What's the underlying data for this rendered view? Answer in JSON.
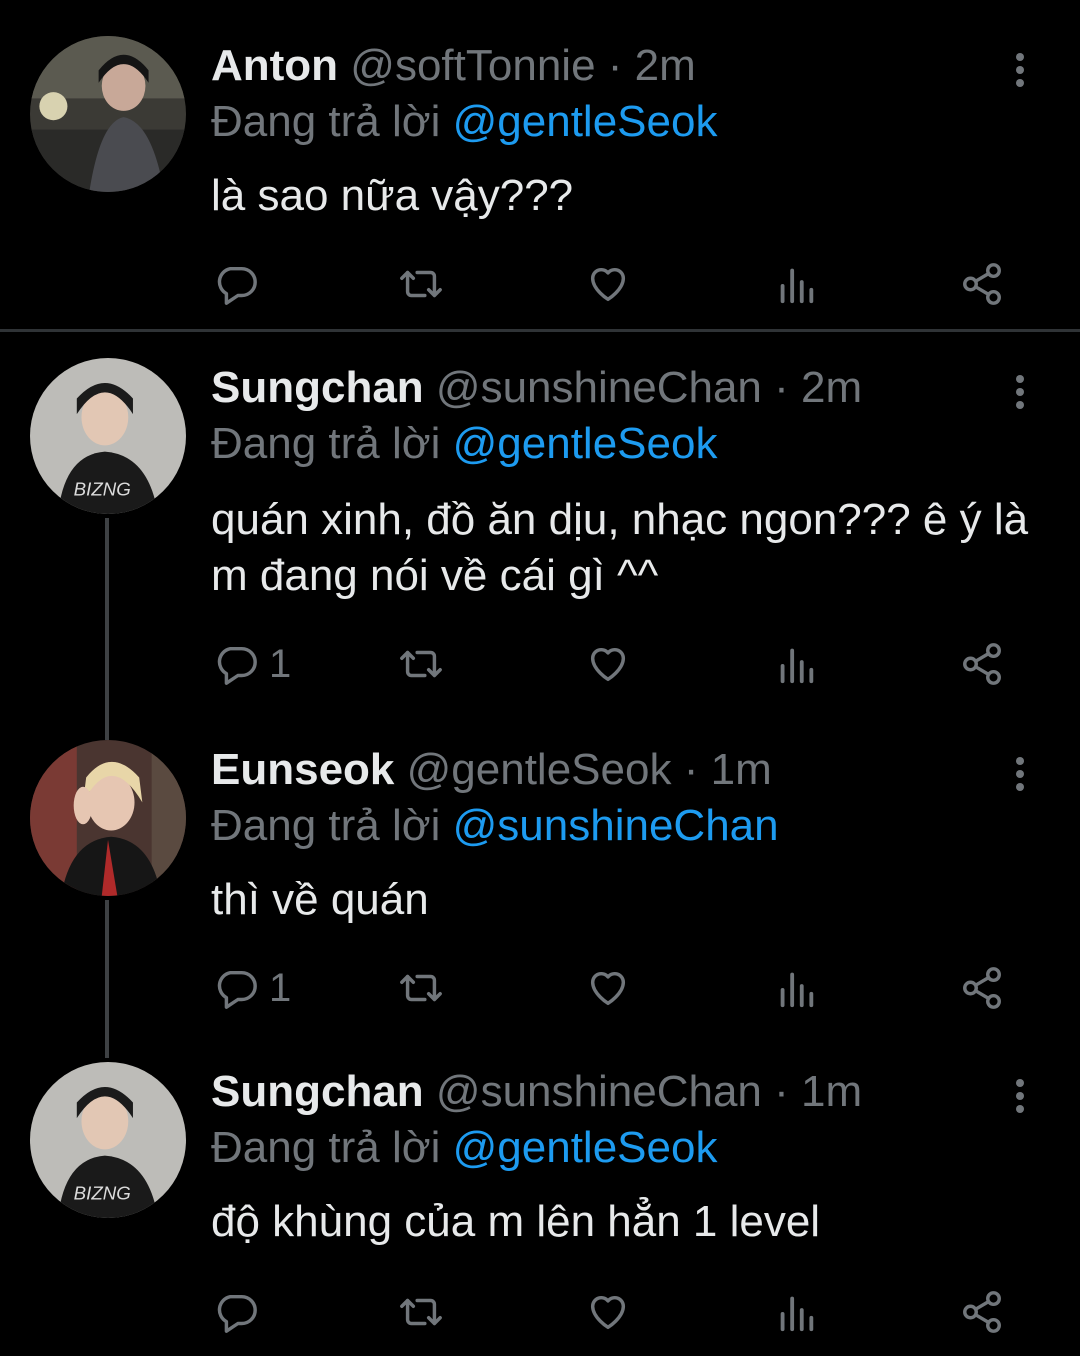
{
  "colors": {
    "background": "#000000",
    "name": "#e7e9ea",
    "muted": "#71767b",
    "accent": "#1d9bf0"
  },
  "tweets": [
    {
      "name": "Anton",
      "handle": "@softTonnie",
      "separator": "·",
      "time": "2m",
      "replying_prefix": "Đang trả lời",
      "replying_to": "@gentleSeok",
      "text": "là sao nữa vậy???",
      "reply_count": "",
      "avatar_icon": "avatar-anton"
    },
    {
      "name": "Sungchan",
      "handle": "@sunshineChan",
      "separator": "·",
      "time": "2m",
      "replying_prefix": "Đang trả lời",
      "replying_to": "@gentleSeok",
      "text": "quán xinh, đồ ăn dịu, nhạc ngon??? ê ý là m đang nói về cái gì ^^",
      "reply_count": "1",
      "avatar_icon": "avatar-sungchan"
    },
    {
      "name": "Eunseok",
      "handle": "@gentleSeok",
      "separator": "·",
      "time": "1m",
      "replying_prefix": "Đang trả lời",
      "replying_to": "@sunshineChan",
      "text": "thì về quán",
      "reply_count": "1",
      "avatar_icon": "avatar-eunseok"
    },
    {
      "name": "Sungchan",
      "handle": "@sunshineChan",
      "separator": "·",
      "time": "1m",
      "replying_prefix": "Đang trả lời",
      "replying_to": "@gentleSeok",
      "text": "độ khùng của m lên hẳn 1 level",
      "reply_count": "",
      "avatar_icon": "avatar-sungchan"
    }
  ],
  "action_icons": [
    "reply-icon",
    "retweet-icon",
    "like-icon",
    "views-icon",
    "share-icon"
  ]
}
